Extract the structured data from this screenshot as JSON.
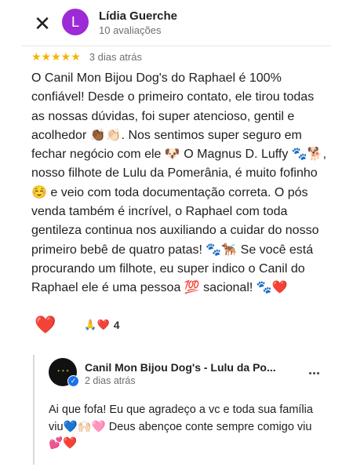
{
  "header": {
    "close_icon": "✕",
    "avatar_letter": "L",
    "avatar_color": "#9c2bd6",
    "author_name": "Lídia Guerche",
    "author_meta": "10 avaliações"
  },
  "review": {
    "rating": 5,
    "stars": "★★★★★",
    "star_color": "#f5b400",
    "date": "3 dias atrás",
    "text": "O Canil Mon Bijou Dog's do Raphael é 100% confiável! Desde o primeiro contato, ele tirou todas as nossas dúvidas, foi super atencioso, gentil e acolhedor 👏🏾👏🏻. Nos sentimos super seguro em fechar negócio com ele 🐶 O Magnus D. Luffy 🐾🐕, nosso filhote de Lulu da Pomerânia, é muito fofinho ☺️ e veio com toda documentação correta. O pós venda também é incrível, o Raphael com toda gentileza continua nos auxiliando a cuidar do nosso primeiro bebê de quatro patas! 🐾🐕‍🦺 Se você está procurando um filhote, eu super indico o Canil do Raphael ele é uma pessoa 💯 sacional! 🐾❤️"
  },
  "reactions": {
    "heart_icon": "❤️",
    "group_icons": "🙏❤️",
    "count": "4"
  },
  "owner_reply": {
    "name": "Canil Mon Bijou Dog's - Lulu da Po...",
    "date": "2 dias atrás",
    "text": "Ai que fofa! Eu que agradeço a vc e toda sua família viu💙🙌🏻🩷 Deus abençoe conte sempre comigo viu 💕❤️"
  }
}
